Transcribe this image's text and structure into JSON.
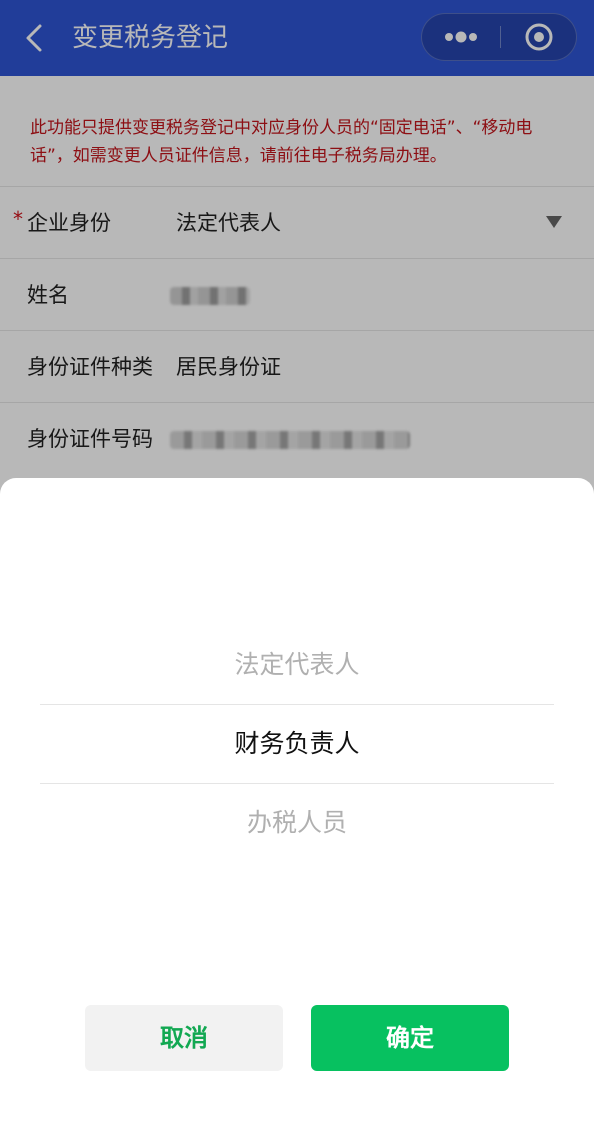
{
  "header": {
    "title": "变更税务登记",
    "colors": {
      "bar": "#2f55d4",
      "text": "#ffffff"
    }
  },
  "notice": {
    "text": "此功能只提供变更税务登记中对应身份人员的“固定电话”、“移动电话”，如需变更人员证件信息，请前往电子税务局办理。",
    "color": "#c4151c"
  },
  "form": {
    "rows": [
      {
        "label": "企业身份",
        "required_mark": "*",
        "value": "法定代表人"
      },
      {
        "label": "姓名"
      },
      {
        "label": "身份证件种类",
        "value": "居民身份证"
      },
      {
        "label": "身份证件号码"
      }
    ]
  },
  "picker": {
    "options": [
      "法定代表人",
      "财务负责人",
      "办税人员"
    ],
    "selected": "财务负责人"
  },
  "actions": {
    "cancel_label": "取消",
    "confirm_label": "确定",
    "confirm_color": "#07c160"
  },
  "icons": {
    "back": "chevron-left-icon",
    "more": "more-dots-icon",
    "close": "target-close-icon",
    "dropdown": "triangle-down-icon"
  }
}
